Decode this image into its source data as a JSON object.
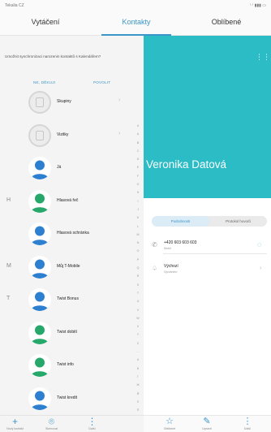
{
  "statusbar": {
    "carrier": "Tekalia CZ",
    "icons": "⁽·⁾ ▮▮▮ ▭"
  },
  "tabs": [
    "Vytáčení",
    "Kontakty",
    "Oblíbené"
  ],
  "sync": {
    "message": "Umožnit synchronizaci narozenin kontaktů s Kalendářem?",
    "no_label": "NE, DĚKUJI",
    "allow_label": "POVOLIT"
  },
  "contacts": [
    {
      "letter": "",
      "name": "Skupiny",
      "avatar": "plain",
      "chevron": true
    },
    {
      "letter": "",
      "name": "Vizitky",
      "avatar": "plain",
      "chevron": true
    },
    {
      "letter": "",
      "name": "Já",
      "avatar": "blue",
      "chevron": false
    },
    {
      "letter": "H",
      "name": "Hlasová řeč",
      "avatar": "green",
      "chevron": false
    },
    {
      "letter": "",
      "name": "Hlasová schránka",
      "avatar": "blue",
      "chevron": false
    },
    {
      "letter": "M",
      "name": "Můj T-Mobile",
      "avatar": "blue",
      "chevron": false
    },
    {
      "letter": "T",
      "name": "Twist Bonus",
      "avatar": "blue",
      "chevron": false
    },
    {
      "letter": "",
      "name": "Twist dobití",
      "avatar": "green",
      "chevron": false
    },
    {
      "letter": "",
      "name": "Twist info",
      "avatar": "green",
      "chevron": false
    },
    {
      "letter": "",
      "name": "Twist kredit",
      "avatar": "blue",
      "chevron": false
    },
    {
      "letter": "V",
      "name": "Veronika Datová",
      "avatar": "blue",
      "chevron": false,
      "selected": true
    }
  ],
  "index_letters": [
    "#",
    "A",
    "B",
    "C",
    "D",
    "E",
    "F",
    "G",
    "H",
    "I",
    "J",
    "K",
    "L",
    "M",
    "N",
    "O",
    "P",
    "Q",
    "R",
    "S",
    "T",
    "U",
    "V",
    "W",
    "X",
    "Y",
    "Z",
    "…",
    "#",
    "Б",
    "Г",
    "Ж",
    "Й",
    "Л",
    "П",
    "Ф"
  ],
  "left_bottom": [
    {
      "icon": "+",
      "label": "Nový kontakt"
    },
    {
      "icon": "⌾",
      "label": "Skenovat"
    },
    {
      "icon": "⋮",
      "label": "Další"
    }
  ],
  "detail": {
    "more_icon": "⋮⋮",
    "name": "Veronika Datová",
    "segments": [
      "Podrobnosti",
      "Protokol hovorů"
    ],
    "phone": {
      "value": "+420 603 603 603",
      "type": "Mobil"
    },
    "ringtone": {
      "value": "Výchozí",
      "type": "Vyzváněcí"
    }
  },
  "right_bottom": [
    {
      "icon": "☆",
      "label": "Oblíbené"
    },
    {
      "icon": "✎",
      "label": "Upravit"
    },
    {
      "icon": "⋮",
      "label": "Další"
    }
  ],
  "colors": {
    "accent": "#3a95c9",
    "hero": "#2bbcc5",
    "avatar_blue": "#2d7fd0",
    "avatar_green": "#25a86a"
  }
}
